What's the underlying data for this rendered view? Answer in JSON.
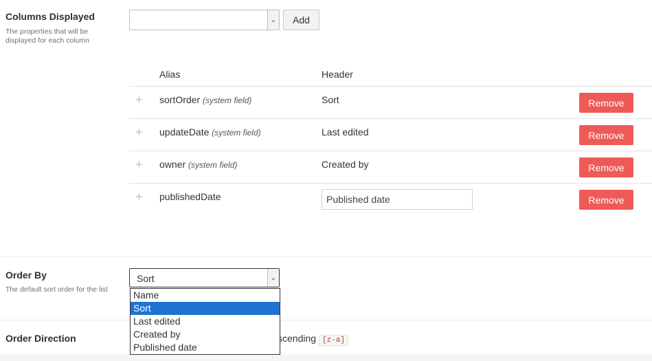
{
  "columns_displayed": {
    "label": "Columns Displayed",
    "description": "The properties that will be displayed for each column",
    "add_label": "Add",
    "table": {
      "headers": {
        "alias": "Alias",
        "header": "Header"
      },
      "rows": [
        {
          "alias": "sortOrder",
          "note": "(system field)",
          "header": "Sort",
          "remove": "Remove"
        },
        {
          "alias": "updateDate",
          "note": "(system field)",
          "header": "Last edited",
          "remove": "Remove"
        },
        {
          "alias": "owner",
          "note": "(system field)",
          "header": "Created by",
          "remove": "Remove"
        },
        {
          "alias": "publishedDate",
          "note": "",
          "header_input": "Published date",
          "remove": "Remove"
        }
      ]
    }
  },
  "order_by": {
    "label": "Order By",
    "description": "The default sort order for the list",
    "selected": "Sort",
    "options": [
      "Name",
      "Sort",
      "Last edited",
      "Created by",
      "Published date"
    ]
  },
  "order_direction": {
    "label": "Order Direction",
    "option_partial": "scending",
    "code": "[z-a]"
  }
}
